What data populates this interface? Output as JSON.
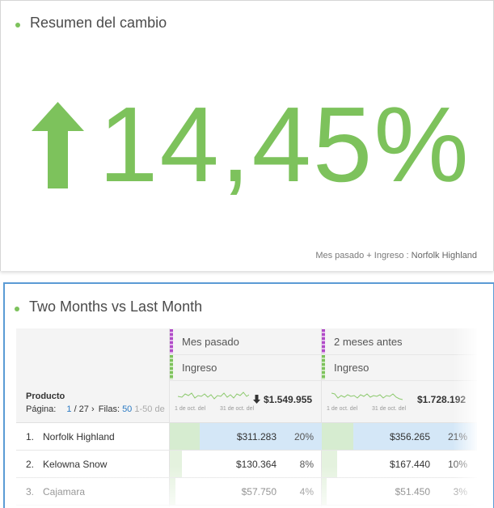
{
  "summary_panel": {
    "title": "Resumen del cambio",
    "value": "14,45%",
    "direction": "up",
    "footnote_metric": "Mes pasado + Ingreso",
    "footnote_sep": ":",
    "footnote_item": "Norfolk Highland",
    "accent_color": "#7dc25c"
  },
  "table_panel": {
    "title": "Two Months vs Last Month",
    "columns": [
      {
        "segment": "Mes pasado",
        "metric": "Ingreso",
        "total": "$1.549.955",
        "total_trend": "down",
        "spark_start": "1 de oct. del",
        "spark_end": "31 de oct. del"
      },
      {
        "segment": "2 meses antes",
        "metric": "Ingreso",
        "total": "$1.728.192",
        "spark_start": "1 de oct. del",
        "spark_end": "31 de oct. del"
      }
    ],
    "dimension_label": "Producto",
    "pager": {
      "page_label": "Página:",
      "current": "1",
      "total": "/ 27",
      "rows_label": "Filas:",
      "rows": "50",
      "range": "1-50 de"
    },
    "rows": [
      {
        "index": "1.",
        "name": "Norfolk Highland",
        "v1": "$311.283",
        "p1": "20%",
        "v2": "$356.265",
        "p2": "21%",
        "f1": 0.2,
        "f2": 0.21,
        "selected": true
      },
      {
        "index": "2.",
        "name": "Kelowna Snow",
        "v1": "$130.364",
        "p1": "8%",
        "v2": "$167.440",
        "p2": "10%",
        "f1": 0.08,
        "f2": 0.1,
        "selected": false
      },
      {
        "index": "3.",
        "name": "Cajamara",
        "v1": "$57.750",
        "p1": "4%",
        "v2": "$51.450",
        "p2": "3%",
        "f1": 0.04,
        "f2": 0.03,
        "selected": false
      }
    ]
  }
}
